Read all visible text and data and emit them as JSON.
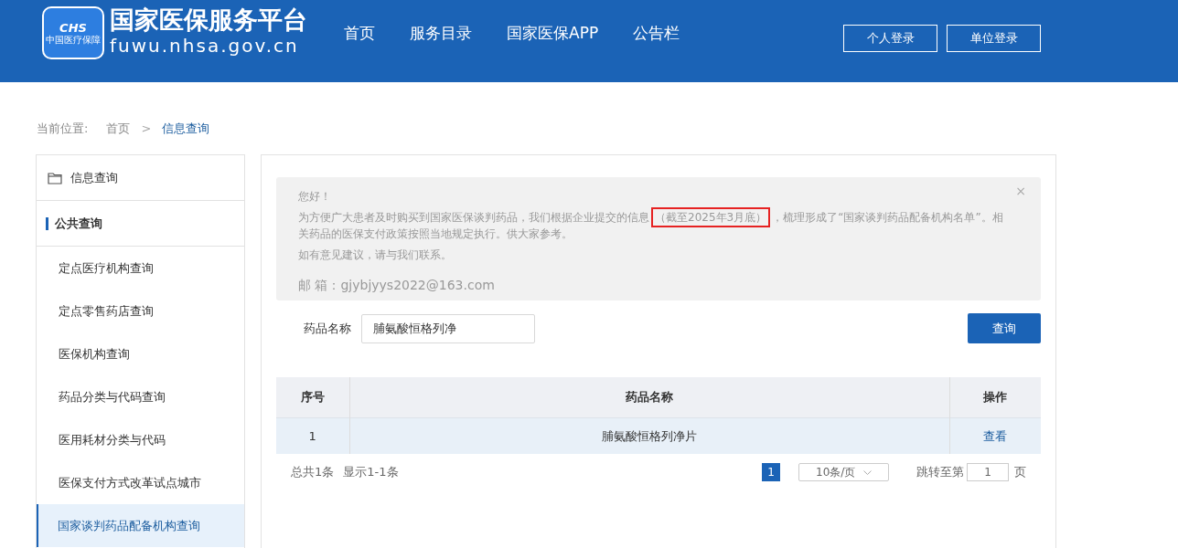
{
  "header": {
    "logo_badge": "CHS",
    "logo_badge_sub": "中国医疗保障",
    "site_name": "国家医保服务平台",
    "site_url": "fuwu.nhsa.gov.cn",
    "nav": [
      {
        "label": "首页",
        "selected": false
      },
      {
        "label": "服务目录",
        "selected": false
      },
      {
        "label": "国家医保APP",
        "selected": false
      },
      {
        "label": "公告栏",
        "selected": false
      }
    ],
    "buttons": [
      "个人登录",
      "单位登录"
    ]
  },
  "breadcrumb": {
    "label": "当前位置:",
    "items": [
      "首页",
      "信息查询"
    ],
    "separator": ">"
  },
  "sidebar": {
    "title": "信息查询",
    "section": "公共查询",
    "items": [
      {
        "label": "定点医疗机构查询",
        "selected": false
      },
      {
        "label": "定点零售药店查询",
        "selected": false
      },
      {
        "label": "医保机构查询",
        "selected": false
      },
      {
        "label": "药品分类与代码查询",
        "selected": false
      },
      {
        "label": "医用耗材分类与代码",
        "selected": false
      },
      {
        "label": "医保支付方式改革试点城市",
        "selected": false
      },
      {
        "label": "国家谈判药品配备机构查询",
        "selected": true
      }
    ]
  },
  "notice": {
    "close": "×",
    "lines": [
      [
        {
          "text": "您好！"
        }
      ],
      [
        {
          "text": "为方便广大患者及时购买到国家医保谈判药品，我们根据企业提交的信息"
        },
        {
          "text": "（截至2025年3月底）",
          "highlight": true
        },
        {
          "text": "，梳理形成了“国家谈判药品配备机构名单”。相关药品的医保支付政策按照当地规定执行。供大家参考。"
        }
      ],
      [
        {
          "text": "如有意见建议，请与我们联系。"
        }
      ]
    ],
    "email": "邮 箱：gjybjyys2022@163.com"
  },
  "search": {
    "label": "药品名称",
    "value": "脯氨酸恒格列净",
    "button": "查询"
  },
  "table": {
    "columns": [
      "序号",
      "药品名称",
      "操作"
    ],
    "rows": [
      {
        "index": "1",
        "name": "脯氨酸恒格列净片",
        "action": "查看"
      }
    ]
  },
  "pagination": {
    "summary": "总共1条",
    "range": "显示1-1条",
    "pages": [
      {
        "label": "1",
        "selected": true
      }
    ],
    "page_size": "10条/页",
    "jump_label": "跳转至第",
    "jump_value": "1",
    "jump_unit": "页"
  }
}
